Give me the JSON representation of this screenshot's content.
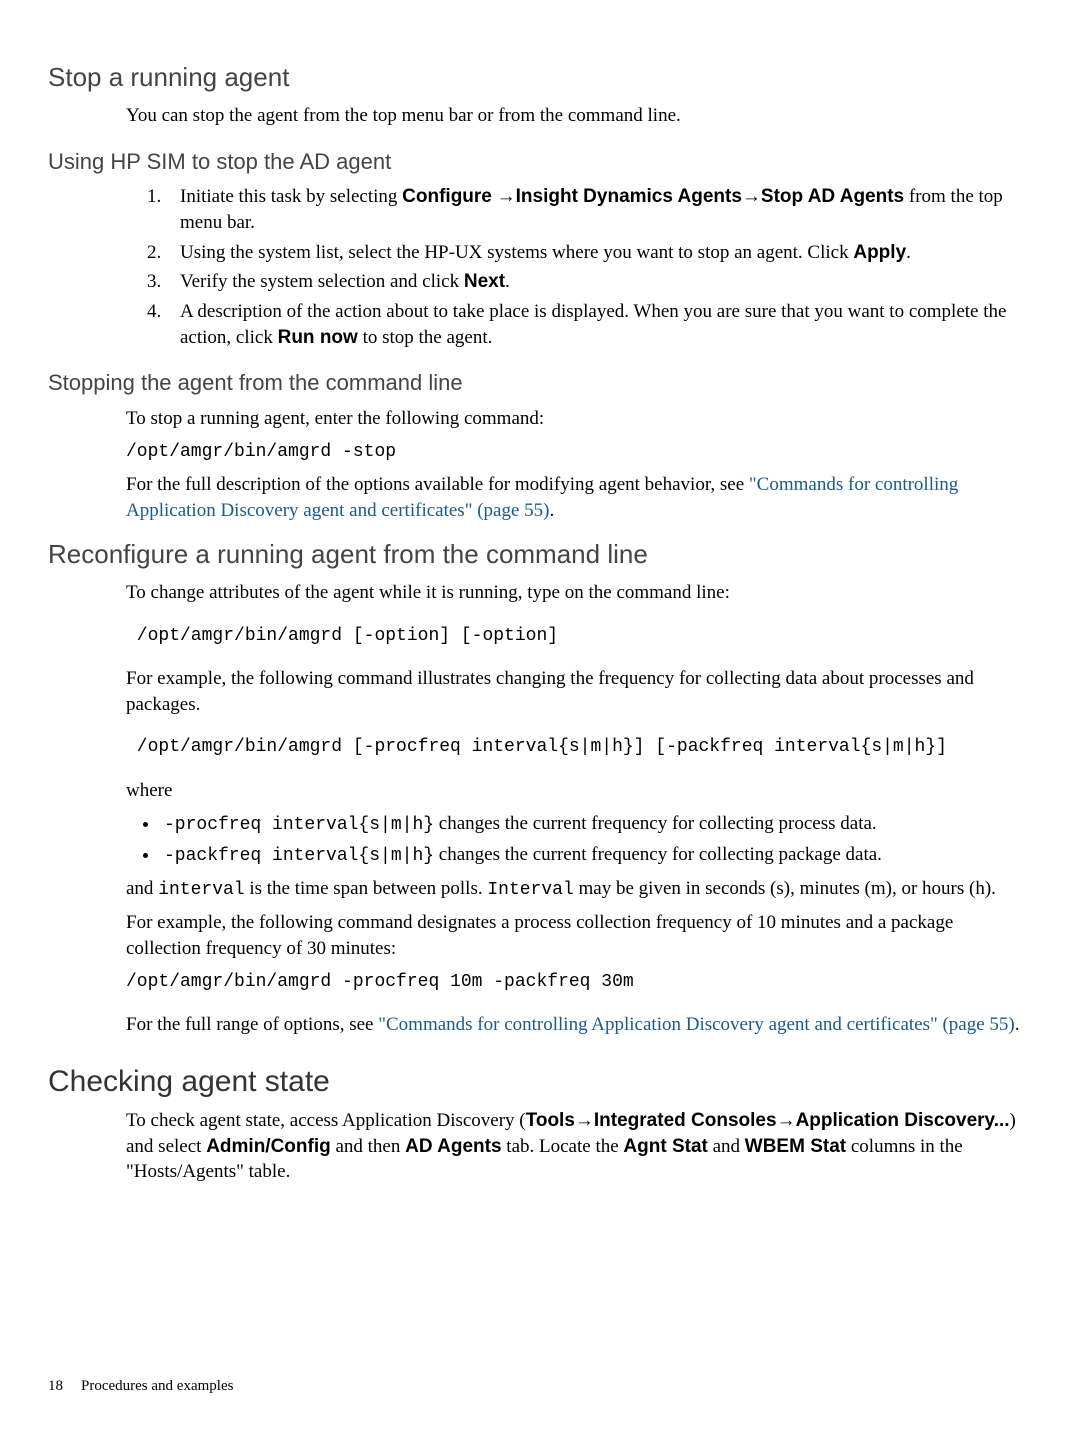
{
  "sec1": {
    "heading": "Stop a running agent",
    "intro": "You can stop the agent from the top menu bar or from the command line.",
    "sub1": {
      "heading": "Using HP SIM to stop the AD agent",
      "item1": {
        "pre": "Initiate this task by selecting ",
        "b1": "Configure",
        "arr1": " →",
        "b2": "Insight Dynamics Agents",
        "arr2": "→",
        "b3": "Stop AD Agents",
        "post": " from the top menu bar."
      },
      "item2": {
        "pre": "Using the system list, select the HP-UX systems where you want to stop an agent. Click ",
        "b": "Apply",
        "post": "."
      },
      "item3": {
        "pre": "Verify the system selection and click ",
        "b": "Next",
        "post": "."
      },
      "item4": {
        "pre": "A description of the action about to take place is displayed. When you are sure that you want to complete the action, click ",
        "b": "Run now",
        "post": " to stop the agent."
      }
    },
    "sub2": {
      "heading": "Stopping the agent from the command line",
      "p1": "To stop a running agent, enter the following command:",
      "cmd": "/opt/amgr/bin/amgrd -stop",
      "p2a": "For the full description of the options available for modifying agent behavior, see ",
      "link": "\"Commands for controlling Application Discovery agent and certificates\" (page 55)",
      "p2b": "."
    }
  },
  "sec2": {
    "heading": "Reconfigure a running agent from the command line",
    "p1": "To change attributes of the agent while it is running, type on the command line:",
    "cmd1": " /opt/amgr/bin/amgrd [-option] [-option]",
    "p2": "For example, the following command illustrates changing the frequency for collecting data about processes and packages.",
    "cmd2": " /opt/amgr/bin/amgrd [-procfreq interval{s|m|h}] [-packfreq interval{s|m|h}]",
    "where": "where",
    "li1": {
      "code": "-procfreq interval{s|m|h}",
      "text": "  changes the current frequency for collecting process data."
    },
    "li2": {
      "code": "-packfreq interval{s|m|h}",
      "text": "  changes the current frequency for collecting package data."
    },
    "p3a": "and ",
    "p3code1": "interval",
    "p3b": " is the time span between polls. ",
    "p3code2": "Interval",
    "p3c": "  may be given in seconds (s), minutes (m), or hours (h).",
    "p4": "For example, the following command designates a process collection frequency of 10 minutes and a package collection frequency of 30 minutes:",
    "cmd3": "/opt/amgr/bin/amgrd -procfreq 10m -packfreq 30m",
    "p5a": "For the full range of options, see ",
    "link": "\"Commands for controlling Application Discovery agent and certificates\" (page 55)",
    "p5b": "."
  },
  "sec3": {
    "heading": "Checking agent state",
    "p": {
      "t1": "To check agent state, access Application Discovery (",
      "b1": "Tools",
      "arr1": "→",
      "b2": "Integrated Consoles",
      "arr2": "→",
      "b3": "Application Discovery...",
      "t2": ") and select ",
      "b4": "Admin/Config",
      "t3": " and then ",
      "b5": "AD Agents",
      "t4": " tab. Locate the ",
      "b6": "Agnt Stat",
      "t5": " and ",
      "b7": "WBEM Stat",
      "t6": " columns in the \"Hosts/Agents\" table."
    }
  },
  "footer": {
    "page": "18",
    "section": "Procedures and examples"
  }
}
